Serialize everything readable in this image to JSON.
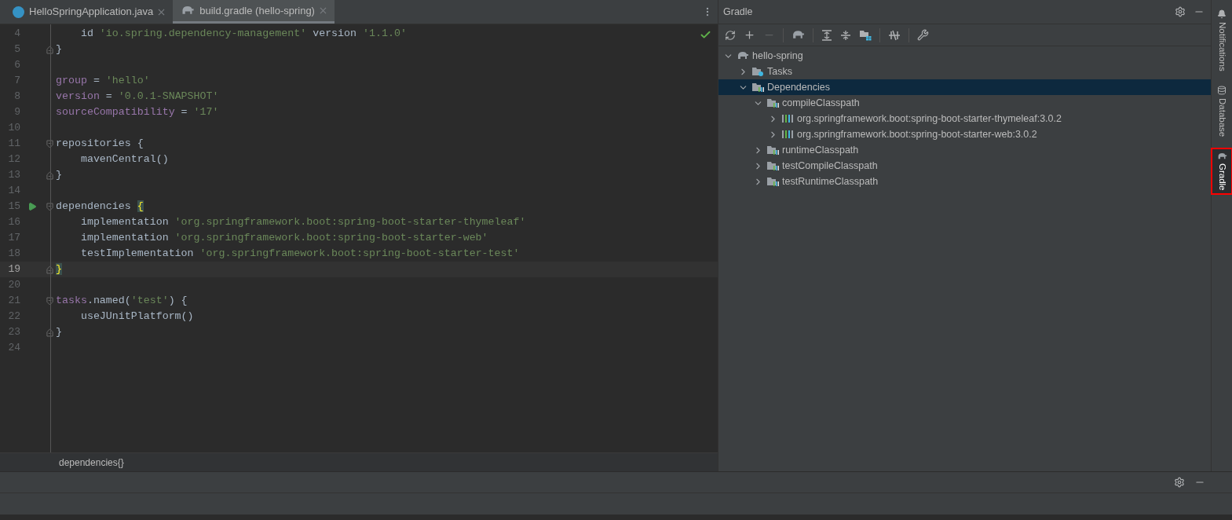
{
  "editor_tabs": [
    {
      "label": "HelloSpringApplication.java",
      "kind": "java",
      "selected": false
    },
    {
      "label": "build.gradle (hello-spring)",
      "kind": "gradle",
      "selected": true
    }
  ],
  "code_lines": [
    {
      "number": "4",
      "fold_start": false,
      "fold_end": false,
      "run": false,
      "current": false,
      "tokens": [
        {
          "kind": "plain",
          "text": "    id "
        },
        {
          "kind": "string",
          "text": "'io.spring.dependency-management'"
        },
        {
          "kind": "plain",
          "text": " version "
        },
        {
          "kind": "string",
          "text": "'1.1.0'"
        }
      ]
    },
    {
      "number": "5",
      "fold_start": false,
      "fold_end": true,
      "run": false,
      "current": false,
      "tokens": [
        {
          "kind": "plain",
          "text": "}"
        }
      ]
    },
    {
      "number": "6",
      "fold_start": false,
      "fold_end": false,
      "run": false,
      "current": false
    },
    {
      "number": "7",
      "fold_start": false,
      "fold_end": false,
      "run": false,
      "current": false,
      "tokens": [
        {
          "kind": "property",
          "text": "group"
        },
        {
          "kind": "plain",
          "text": " = "
        },
        {
          "kind": "string",
          "text": "'hello'"
        }
      ]
    },
    {
      "number": "8",
      "fold_start": false,
      "fold_end": false,
      "run": false,
      "current": false,
      "tokens": [
        {
          "kind": "property",
          "text": "version"
        },
        {
          "kind": "plain",
          "text": " = "
        },
        {
          "kind": "string",
          "text": "'0.0.1-SNAPSHOT'"
        }
      ]
    },
    {
      "number": "9",
      "fold_start": false,
      "fold_end": false,
      "run": false,
      "current": false,
      "tokens": [
        {
          "kind": "property",
          "text": "sourceCompatibility"
        },
        {
          "kind": "plain",
          "text": " = "
        },
        {
          "kind": "string",
          "text": "'17'"
        }
      ]
    },
    {
      "number": "10",
      "fold_start": false,
      "fold_end": false,
      "run": false,
      "current": false
    },
    {
      "number": "11",
      "fold_start": true,
      "fold_end": false,
      "run": false,
      "current": false,
      "tokens": [
        {
          "kind": "plain",
          "text": "repositories {"
        }
      ]
    },
    {
      "number": "12",
      "fold_start": false,
      "fold_end": false,
      "run": false,
      "current": false,
      "tokens": [
        {
          "kind": "plain",
          "text": "    mavenCentral()"
        }
      ]
    },
    {
      "number": "13",
      "fold_start": false,
      "fold_end": true,
      "run": false,
      "current": false,
      "tokens": [
        {
          "kind": "plain",
          "text": "}"
        }
      ]
    },
    {
      "number": "14",
      "fold_start": false,
      "fold_end": false,
      "run": false,
      "current": false
    },
    {
      "number": "15",
      "fold_start": true,
      "fold_end": false,
      "run": true,
      "current": false,
      "tokens": [
        {
          "kind": "plain",
          "text": "dependencies "
        },
        {
          "kind": "brace",
          "text": "{"
        }
      ]
    },
    {
      "number": "16",
      "fold_start": false,
      "fold_end": false,
      "run": false,
      "current": false,
      "tokens": [
        {
          "kind": "plain",
          "text": "    implementation "
        },
        {
          "kind": "string",
          "text": "'org.springframework.boot:spring-boot-starter-thymeleaf'"
        }
      ]
    },
    {
      "number": "17",
      "fold_start": false,
      "fold_end": false,
      "run": false,
      "current": false,
      "tokens": [
        {
          "kind": "plain",
          "text": "    implementation "
        },
        {
          "kind": "string",
          "text": "'org.springframework.boot:spring-boot-starter-web'"
        }
      ]
    },
    {
      "number": "18",
      "fold_start": false,
      "fold_end": false,
      "run": false,
      "current": false,
      "tokens": [
        {
          "kind": "plain",
          "text": "    testImplementation "
        },
        {
          "kind": "string",
          "text": "'org.springframework.boot:spring-boot-starter-test'"
        }
      ]
    },
    {
      "number": "19",
      "fold_start": false,
      "fold_end": true,
      "run": false,
      "current": true,
      "tokens": [
        {
          "kind": "brace",
          "text": "}"
        }
      ]
    },
    {
      "number": "20",
      "fold_start": false,
      "fold_end": false,
      "run": false,
      "current": false
    },
    {
      "number": "21",
      "fold_start": true,
      "fold_end": false,
      "run": false,
      "current": false,
      "tokens": [
        {
          "kind": "property",
          "text": "tasks"
        },
        {
          "kind": "plain",
          "text": ".named("
        },
        {
          "kind": "string",
          "text": "'test'"
        },
        {
          "kind": "plain",
          "text": ") {"
        }
      ]
    },
    {
      "number": "22",
      "fold_start": false,
      "fold_end": false,
      "run": false,
      "current": false,
      "tokens": [
        {
          "kind": "plain",
          "text": "    useJUnitPlatform()"
        }
      ]
    },
    {
      "number": "23",
      "fold_start": false,
      "fold_end": true,
      "run": false,
      "current": false,
      "tokens": [
        {
          "kind": "plain",
          "text": "}"
        }
      ]
    },
    {
      "number": "24",
      "fold_start": false,
      "fold_end": false,
      "run": false,
      "current": false
    }
  ],
  "breadcrumb": "dependencies{}",
  "gradle_panel": {
    "title": "Gradle",
    "tree": [
      {
        "label": "hello-spring",
        "kind": "project",
        "expanded": true,
        "selected": false,
        "children": [
          {
            "label": "Tasks",
            "kind": "tasks",
            "expanded": false,
            "selected": false
          },
          {
            "label": "Dependencies",
            "kind": "config",
            "expanded": true,
            "selected": true,
            "children": [
              {
                "label": "compileClasspath",
                "kind": "config",
                "expanded": true,
                "selected": false,
                "children": [
                  {
                    "label": "org.springframework.boot:spring-boot-starter-thymeleaf:3.0.2",
                    "kind": "library",
                    "expanded": false,
                    "selected": false
                  },
                  {
                    "label": "org.springframework.boot:spring-boot-starter-web:3.0.2",
                    "kind": "library",
                    "expanded": false,
                    "selected": false
                  }
                ]
              },
              {
                "label": "runtimeClasspath",
                "kind": "config",
                "expanded": false,
                "selected": false
              },
              {
                "label": "testCompileClasspath",
                "kind": "config",
                "expanded": false,
                "selected": false
              },
              {
                "label": "testRuntimeClasspath",
                "kind": "config",
                "expanded": false,
                "selected": false
              }
            ]
          }
        ]
      }
    ]
  },
  "side_tools": [
    {
      "label": "Notifications",
      "kind": "bell",
      "selected": false
    },
    {
      "label": "Database",
      "kind": "database",
      "selected": false
    },
    {
      "label": "Gradle",
      "kind": "gradle",
      "selected": true
    }
  ]
}
